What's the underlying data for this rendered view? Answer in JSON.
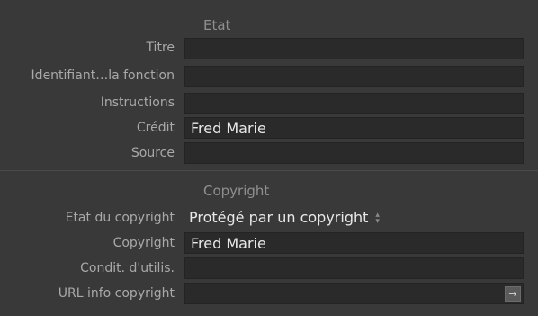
{
  "etat": {
    "title": "Etat",
    "rows": [
      {
        "label": "Titre",
        "value": ""
      },
      {
        "label": "Identifiant…la fonction",
        "value": ""
      },
      {
        "label": "Instructions",
        "value": ""
      },
      {
        "label": "Crédit",
        "value": "Fred Marie"
      },
      {
        "label": "Source",
        "value": ""
      }
    ]
  },
  "copyright": {
    "title": "Copyright",
    "status_label": "Etat du copyright",
    "status_value": "Protégé par un copyright",
    "copyright_label": "Copyright",
    "copyright_value": "Fred Marie",
    "terms_label": "Condit. d'utilis.",
    "terms_value": "",
    "url_label": "URL info copyright",
    "url_value": "",
    "url_button": "→"
  },
  "colors": {
    "background": "#393939",
    "field_background": "#2a2a2a",
    "label_text": "#a9a9a9",
    "value_text": "#e8e8e8",
    "section_title": "#8f8f8f"
  }
}
